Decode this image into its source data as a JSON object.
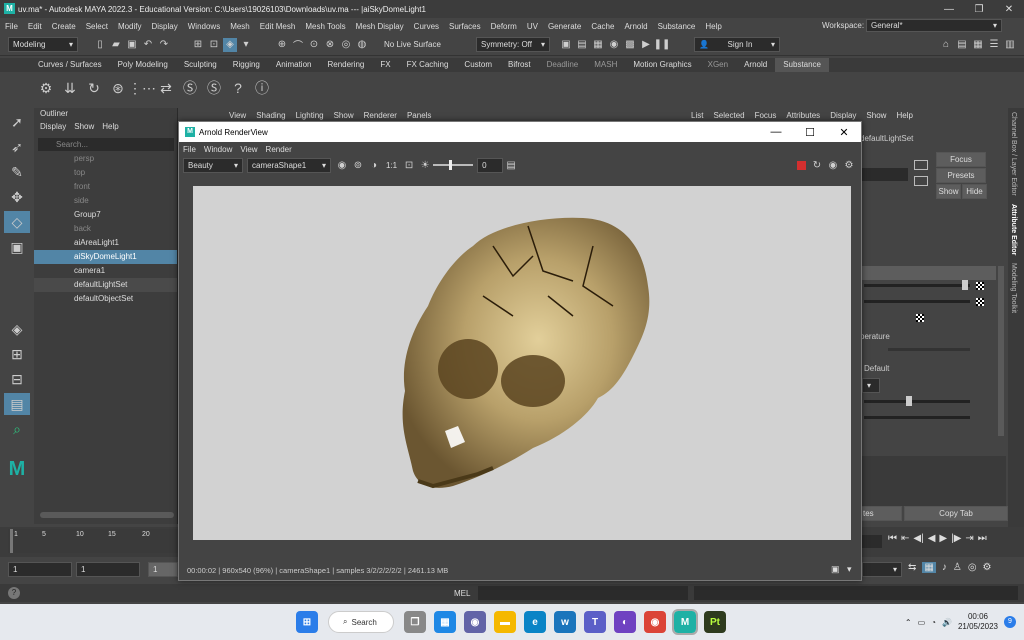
{
  "window": {
    "title": "uv.ma* - Autodesk MAYA 2022.3 - Educational Version: C:\\Users\\19026103\\Downloads\\uv.ma   ---   |aiSkyDomeLight1"
  },
  "menubar": [
    "File",
    "Edit",
    "Create",
    "Select",
    "Modify",
    "Display",
    "Windows",
    "Mesh",
    "Edit Mesh",
    "Mesh Tools",
    "Mesh Display",
    "Curves",
    "Surfaces",
    "Deform",
    "UV",
    "Generate",
    "Cache",
    "Arnold",
    "Substance",
    "Help"
  ],
  "workspace": {
    "label": "Workspace:",
    "value": "General*"
  },
  "statusline": {
    "mode": "Modeling",
    "live_surface": "No Live Surface",
    "symmetry": "Symmetry: Off",
    "sign_in": "Sign In"
  },
  "shelf_tabs": [
    "Curves / Surfaces",
    "Poly Modeling",
    "Sculpting",
    "Rigging",
    "Animation",
    "Rendering",
    "FX",
    "FX Caching",
    "Custom",
    "Bifrost",
    "Deadline",
    "MASH",
    "Motion Graphics",
    "XGen",
    "Arnold",
    "Substance"
  ],
  "shelf_active": "Substance",
  "outliner": {
    "title": "Outliner",
    "menu": [
      "Display",
      "Show",
      "Help"
    ],
    "search_placeholder": "Search...",
    "items": [
      {
        "label": "persp",
        "dim": true
      },
      {
        "label": "top",
        "dim": true
      },
      {
        "label": "front",
        "dim": true
      },
      {
        "label": "side",
        "dim": true
      },
      {
        "label": "Group7",
        "dim": false
      },
      {
        "label": "back",
        "dim": true
      },
      {
        "label": "aiAreaLight1",
        "dim": false
      },
      {
        "label": "aiSkyDomeLight1",
        "dim": false,
        "selected": true
      },
      {
        "label": "camera1",
        "dim": false
      },
      {
        "label": "defaultLightSet",
        "dim": false
      },
      {
        "label": "defaultObjectSet",
        "dim": false
      }
    ]
  },
  "panel_menu": [
    "View",
    "Shading",
    "Lighting",
    "Show",
    "Renderer",
    "Panels"
  ],
  "right_menu": [
    "List",
    "Selected",
    "Focus",
    "Attributes",
    "Display",
    "Show",
    "Help"
  ],
  "attr": {
    "node": "defaultLightSet",
    "focus": "Focus",
    "presets": "Presets",
    "show": "Show",
    "hide": "Hide",
    "temperature": "perature",
    "default": "Default",
    "copy_tab": "Copy Tab",
    "select": "tes"
  },
  "vertical_tabs": [
    "Channel Box / Layer Editor",
    "Attribute Editor",
    "Modeling Toolkit"
  ],
  "renderview": {
    "title": "Arnold RenderView",
    "menu": [
      "File",
      "Window",
      "View",
      "Render"
    ],
    "aov": "Beauty",
    "camera": "cameraShape1",
    "ratio": "1:1",
    "exposure": "0",
    "status": "00:00:02 | 960x540 (96%) | cameraShape1 | samples 3/2/2/2/2/2 | 2461.13 MB"
  },
  "timeline": {
    "ticks": [
      "1",
      "5",
      "10",
      "15",
      "20"
    ]
  },
  "range": {
    "start": "1",
    "inner": "1",
    "end": "1"
  },
  "cmdline": {
    "label": "MEL"
  },
  "taskbar": {
    "search": "Search",
    "time": "00:06",
    "date": "21/05/2023",
    "badge": "9"
  }
}
